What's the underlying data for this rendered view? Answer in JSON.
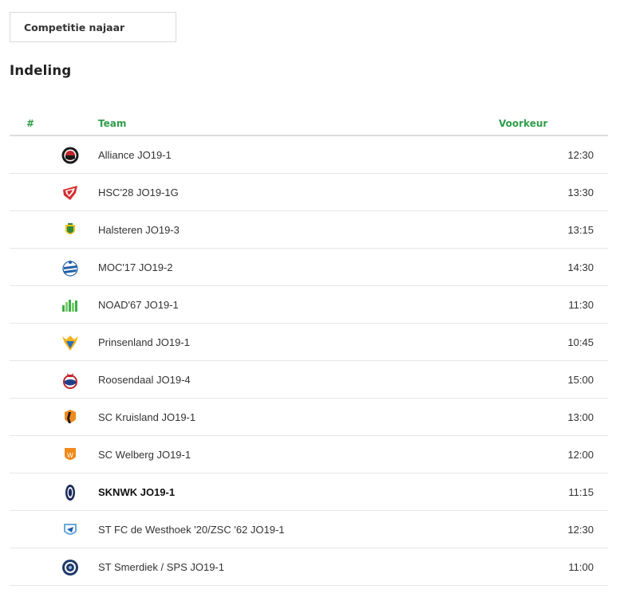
{
  "competition_button": {
    "label": "Competitie najaar"
  },
  "section_title": "Indeling",
  "accent_color": "#2e9d4a",
  "table": {
    "headers": {
      "number": "#",
      "team": "Team",
      "preference": "Voorkeur"
    },
    "rows": [
      {
        "team": "Alliance JO19-1",
        "preference": "12:30",
        "logo": "alliance-logo-icon",
        "bold": false
      },
      {
        "team": "HSC'28 JO19-1G",
        "preference": "13:30",
        "logo": "hsc28-logo-icon",
        "bold": false
      },
      {
        "team": "Halsteren JO19-3",
        "preference": "13:15",
        "logo": "halsteren-logo-icon",
        "bold": false
      },
      {
        "team": "MOC'17 JO19-2",
        "preference": "14:30",
        "logo": "moc17-logo-icon",
        "bold": false
      },
      {
        "team": "NOAD'67 JO19-1",
        "preference": "11:30",
        "logo": "noad67-logo-icon",
        "bold": false
      },
      {
        "team": "Prinsenland JO19-1",
        "preference": "10:45",
        "logo": "prinsenland-logo-icon",
        "bold": false
      },
      {
        "team": "Roosendaal JO19-4",
        "preference": "15:00",
        "logo": "roosendaal-logo-icon",
        "bold": false
      },
      {
        "team": "SC Kruisland JO19-1",
        "preference": "13:00",
        "logo": "sc-kruisland-logo-icon",
        "bold": false
      },
      {
        "team": "SC Welberg JO19-1",
        "preference": "12:00",
        "logo": "sc-welberg-logo-icon",
        "bold": false
      },
      {
        "team": "SKNWK JO19-1",
        "preference": "11:15",
        "logo": "sknwk-logo-icon",
        "bold": true
      },
      {
        "team": "ST FC de Westhoek '20/ZSC '62 JO19-1",
        "preference": "12:30",
        "logo": "westhoek-logo-icon",
        "bold": false
      },
      {
        "team": "ST Smerdiek / SPS JO19-1",
        "preference": "11:00",
        "logo": "smerdiek-logo-icon",
        "bold": false
      }
    ]
  }
}
